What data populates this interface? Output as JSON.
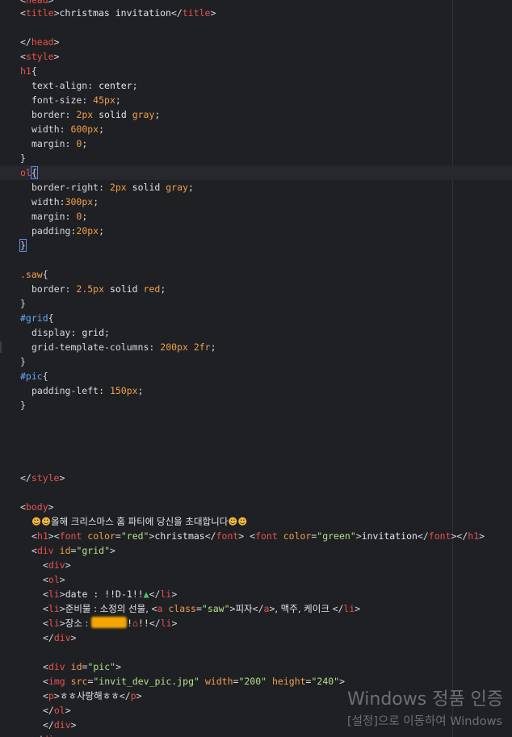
{
  "lines": {
    "l_head_open": "head",
    "l_title_text": "christmas invitation",
    "l_title_tag": "title",
    "l_head": "head",
    "l_style": "style",
    "h1_sel": "h1",
    "h1_p1": "text-align",
    "h1_v1": "center",
    "h1_p2": "font-size",
    "h1_v2": "45px",
    "h1_p3": "border",
    "h1_v3a": "2px",
    "h1_v3b": "solid",
    "h1_v3c": "gray",
    "h1_p4": "width",
    "h1_v4": "600px",
    "h1_p5": "margin",
    "h1_v5": "0",
    "ol_sel": "ol",
    "ol_p1": "border-right",
    "ol_v1a": "2px",
    "ol_v1b": "solid",
    "ol_v1c": "gray",
    "ol_p2": "width",
    "ol_v2": "300px",
    "ol_p3": "margin",
    "ol_v3": "0",
    "ol_p4": "padding",
    "ol_v4": "20px",
    "saw_sel": ".saw",
    "saw_p1": "border",
    "saw_v1a": "2.5px",
    "saw_v1b": "solid",
    "saw_v1c": "red",
    "grid_sel": "#grid",
    "grid_p1": "display",
    "grid_v1": "grid",
    "grid_p2": "grid-template-columns",
    "grid_v2a": "200px",
    "grid_v2b": "2fr",
    "pic_sel": "#pic",
    "pic_p1": "padding-left",
    "pic_v1": "150px",
    "l_style_close": "style",
    "l_body": "body",
    "body_heading": "올해 크리스마스 홈 파티에 당신을 초대합니다",
    "h1_tag": "h1",
    "font_tag": "font",
    "color_attr": "color",
    "red_str": "\"red\"",
    "christmas_text": "christmas",
    "green_str": "\"green\"",
    "invitation_text": "invitation",
    "div_tag": "div",
    "id_attr": "id",
    "grid_str": "\"grid\"",
    "ol_tag": "ol",
    "li_tag": "li",
    "date_text": "date : !!D-1!!",
    "gift_text": "준비물 : 소정의 선물, ",
    "a_tag": "a",
    "class_attr": "class",
    "saw_str": "\"saw\"",
    "pizza_text": "피자",
    "gift_rest": ", 맥주, 케이크 ",
    "place_text": "장소 : ",
    "place_after": "!!",
    "pic_str": "\"pic\"",
    "img_tag": "img",
    "src_attr": "src",
    "src_str": "\"invit_dev_pic.jpg\"",
    "width_attr": "width",
    "width_str": "\"200\"",
    "height_attr": "height",
    "height_str": "\"240\"",
    "p_tag": "p",
    "p_text": "ㅎㅎ사랑해ㅎㅎ"
  },
  "watermark": {
    "title": "Windows 정품 인증",
    "subtitle": "[설정]으로 이동하여 Windows"
  },
  "colors": {
    "background": "#1f2024",
    "tag": "#e8534f",
    "value": "#f0a04b",
    "string": "#b5e08c",
    "id_selector": "#5fa8f0",
    "cursor": "#5b8df5"
  }
}
